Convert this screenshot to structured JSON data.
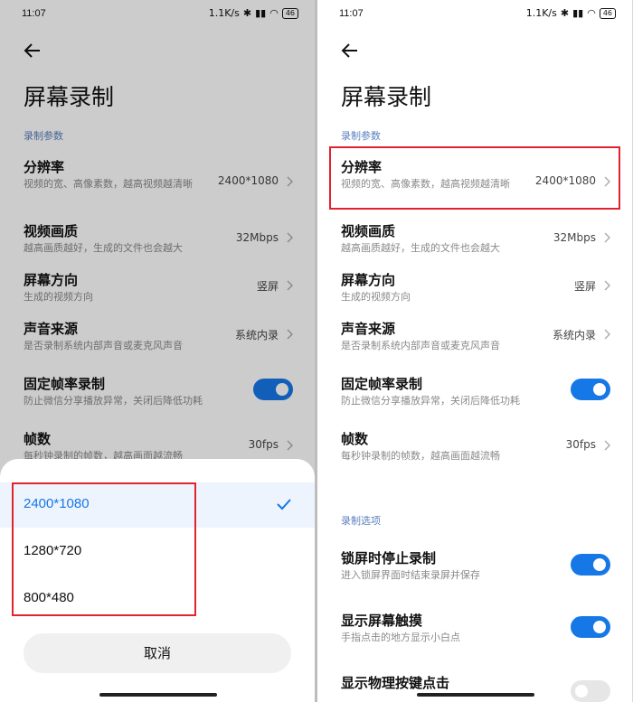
{
  "status": {
    "time": "11:07",
    "speed": "1.1K/s",
    "battery": "46"
  },
  "page_title": "屏幕录制",
  "sections": {
    "params": "录制参数",
    "options": "录制选项"
  },
  "settings": {
    "resolution": {
      "title": "分辨率",
      "desc": "视频的宽、高像素数，越高视频越清晰",
      "value": "2400*1080"
    },
    "quality": {
      "title": "视频画质",
      "desc": "越高画质越好，生成的文件也会越大",
      "value": "32Mbps"
    },
    "orientation": {
      "title": "屏幕方向",
      "desc": "生成的视频方向",
      "value": "竖屏"
    },
    "audio": {
      "title": "声音来源",
      "desc": "是否录制系统内部声音或麦克风声音",
      "value": "系统内录"
    },
    "fixed_fps": {
      "title": "固定帧率录制",
      "desc": "防止微信分享播放异常，关闭后降低功耗",
      "on": true
    },
    "fps": {
      "title": "帧数",
      "desc": "每秒钟录制的帧数，越高画面越流畅",
      "value": "30fps"
    },
    "lock_stop": {
      "title": "锁屏时停止录制",
      "desc": "进入锁屏界面时结束录屏并保存",
      "on": true
    },
    "show_touch": {
      "title": "显示屏幕触摸",
      "desc": "手指点击的地方显示小白点",
      "on": true
    },
    "show_keys": {
      "title": "显示物理按键点击",
      "on": false
    }
  },
  "sheet": {
    "options": [
      "2400*1080",
      "1280*720",
      "800*480"
    ],
    "selected_index": 0,
    "cancel": "取消"
  },
  "colors": {
    "accent": "#1677e6",
    "highlight": "#e0232e"
  },
  "icons": {
    "back": "arrow-left-icon",
    "chevron": "chevron-right-icon",
    "check": "checkmark-icon"
  }
}
